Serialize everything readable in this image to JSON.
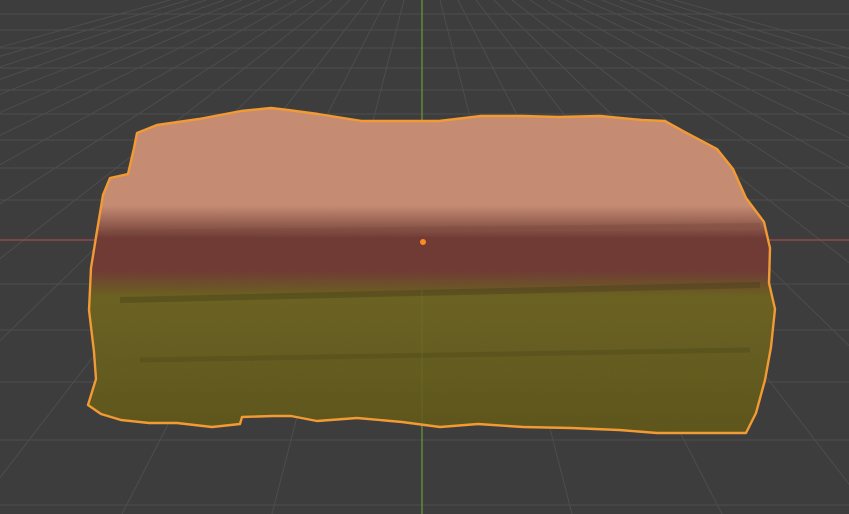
{
  "viewport": {
    "editor": "3D Viewport",
    "background_color": "#3d3d3d",
    "grid": {
      "visible": true,
      "line_color": "#4d4d4d",
      "x_axis_color": "#a8474f",
      "y_axis_color": "#6b9b37"
    },
    "selected_object": {
      "shape": "rough-stone-block",
      "selected": true,
      "outline_color": "#f29a33",
      "origin_color": "#ff8a1e",
      "material": {
        "top_color": "#c58e76",
        "band_color": "#6f3c37",
        "bottom_color": "#6b6322"
      }
    }
  }
}
